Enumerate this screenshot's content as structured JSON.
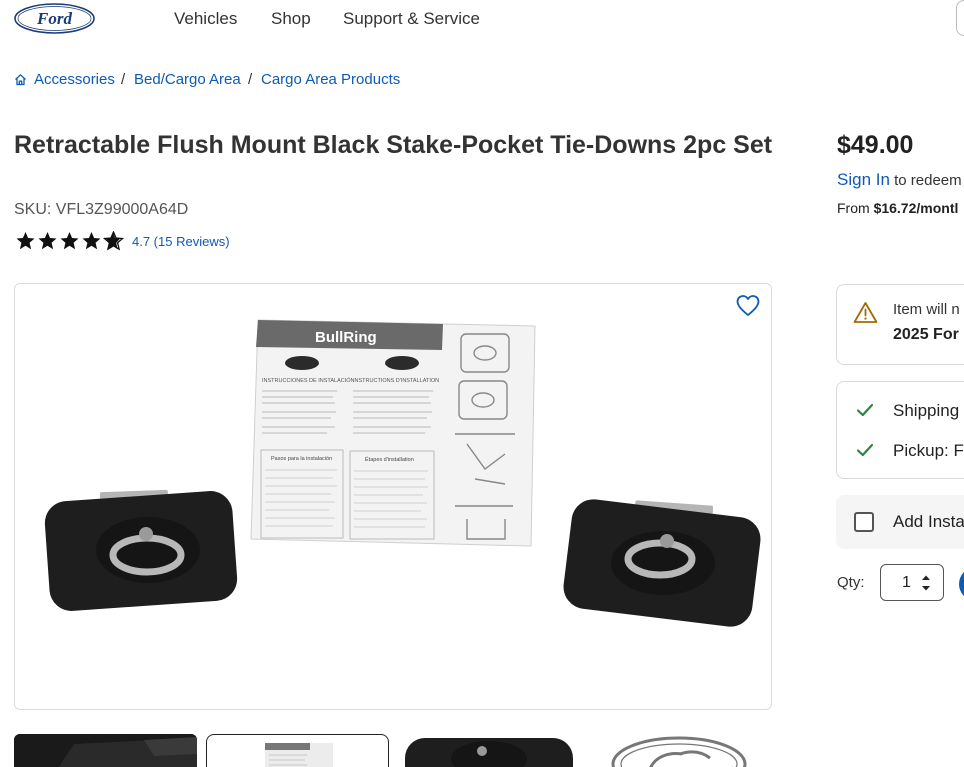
{
  "header": {
    "logo_text": "Ford",
    "nav": [
      {
        "label": "Vehicles"
      },
      {
        "label": "Shop"
      },
      {
        "label": "Support & Service"
      }
    ]
  },
  "breadcrumb": [
    {
      "label": "Accessories"
    },
    {
      "label": "Bed/Cargo Area"
    },
    {
      "label": "Cargo Area Products"
    }
  ],
  "breadcrumb_separator": "/",
  "product": {
    "title": "Retractable Flush Mount Black Stake-Pocket Tie-Downs 2pc Set",
    "sku": "SKU: VFL3Z99000A64D",
    "rating_value": 4.7,
    "rating_text": "4.7 (15 Reviews)",
    "image_text": {
      "brand": "BullRing",
      "left_heading": "INSTRUCCIONES DE INSTALACIÓN",
      "right_heading": "INSTRUCTIONS D'INSTALLATION",
      "left_steps": "Pasos para la instalación",
      "right_steps": "Étapes d'installation"
    }
  },
  "pricing": {
    "price": "$49.00",
    "sign_in_label": "Sign In",
    "sign_in_suffix": " to redeem",
    "from_prefix": "From ",
    "monthly": "$16.72/montl"
  },
  "fitment": {
    "line1": "Item will n",
    "line2": "2025 For"
  },
  "fulfillment": {
    "shipping": "Shipping",
    "pickup": "Pickup: F"
  },
  "install": {
    "label": "Add Insta"
  },
  "quantity": {
    "label": "Qty:",
    "value": "1"
  },
  "colors": {
    "link": "#0d5bb5",
    "brand_navy": "#1b3a7a",
    "check_green": "#2e8540",
    "warning": "#a66a00"
  },
  "icons": [
    "home-icon",
    "star-icon",
    "heart-icon",
    "warning-icon",
    "check-icon",
    "chevron-updown-icon"
  ]
}
